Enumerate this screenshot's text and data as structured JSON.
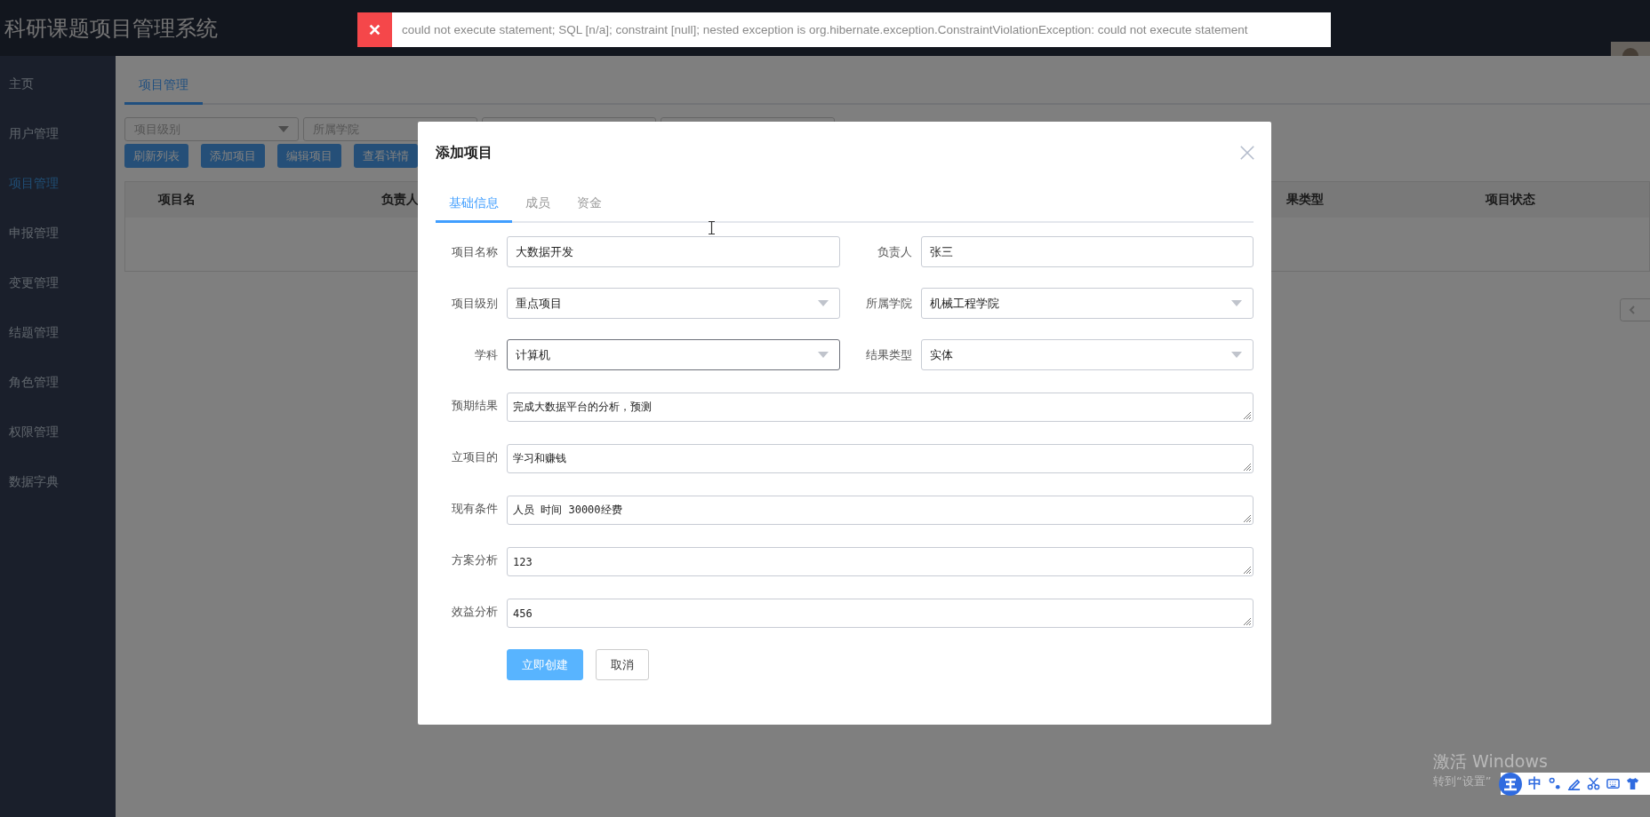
{
  "app": {
    "title": "科研课题项目管理系统"
  },
  "toast": {
    "kind": "error",
    "message": "could not execute statement; SQL [n/a]; constraint [null]; nested exception is org.hibernate.exception.ConstraintViolationException: could not execute statement"
  },
  "sidebar": {
    "items": [
      {
        "label": "主页",
        "selected": false
      },
      {
        "label": "用户管理",
        "selected": false
      },
      {
        "label": "项目管理",
        "selected": true
      },
      {
        "label": "申报管理",
        "selected": false
      },
      {
        "label": "变更管理",
        "selected": false
      },
      {
        "label": "结题管理",
        "selected": false
      },
      {
        "label": "角色管理",
        "selected": false
      },
      {
        "label": "权限管理",
        "selected": false
      },
      {
        "label": "数据字典",
        "selected": false
      }
    ]
  },
  "page": {
    "tabs": [
      {
        "label": "项目管理",
        "selected": true
      }
    ],
    "filters": [
      {
        "placeholder": "项目级别"
      },
      {
        "placeholder": "所属学院"
      }
    ],
    "buttons": [
      "刷新列表",
      "添加项目",
      "编辑项目",
      "查看详情"
    ],
    "table": {
      "columns": [
        "项目名",
        "负责人",
        "果类型",
        "项目状态"
      ]
    }
  },
  "modal": {
    "title": "添加项目",
    "tabs": [
      {
        "label": "基础信息",
        "selected": true
      },
      {
        "label": "成员",
        "selected": false
      },
      {
        "label": "资金",
        "selected": false
      }
    ],
    "fields": [
      {
        "label": "项目名称",
        "kind": "input",
        "value": "大数据开发",
        "focused": false
      },
      {
        "label": "负责人",
        "kind": "input",
        "value": "张三",
        "focused": false
      },
      {
        "label": "项目级别",
        "kind": "select",
        "value": "重点项目",
        "focused": false
      },
      {
        "label": "所属学院",
        "kind": "select",
        "value": "机械工程学院",
        "focused": false
      },
      {
        "label": "学科",
        "kind": "select",
        "value": "计算机",
        "focused": true
      },
      {
        "label": "结果类型",
        "kind": "select",
        "value": "实体",
        "focused": false
      },
      {
        "label": "预期结果",
        "kind": "textarea",
        "value": "完成大数据平台的分析，预测",
        "focused": false
      },
      {
        "label": "立项目的",
        "kind": "textarea",
        "value": "学习和赚钱",
        "focused": false
      },
      {
        "label": "现有条件",
        "kind": "textarea",
        "value": "人员 时间 30000经费",
        "focused": false
      },
      {
        "label": "方案分析",
        "kind": "textarea",
        "value": "123",
        "focused": false
      },
      {
        "label": "效益分析",
        "kind": "textarea",
        "value": "456",
        "focused": false
      }
    ],
    "buttons": [
      {
        "label": "立即创建",
        "kind": "primary"
      },
      {
        "label": "取消",
        "kind": "default"
      }
    ]
  },
  "os_overlay": {
    "activation_lines": [
      "激活 Windows",
      "转到“设置”"
    ],
    "ime_mode": "中"
  }
}
